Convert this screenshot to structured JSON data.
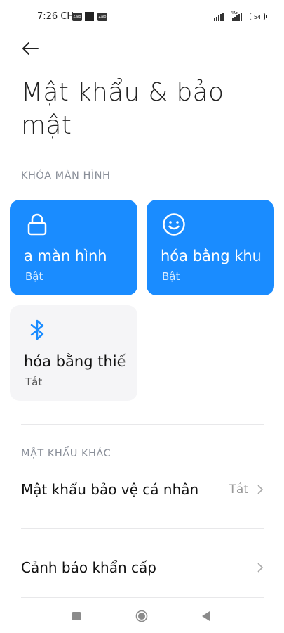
{
  "status_bar": {
    "time": "7:26 CH",
    "notif_1": "Zalo",
    "notif_2": "Zalo",
    "network": "4G",
    "battery": "54"
  },
  "header": {
    "back_icon": "back-arrow-icon",
    "title": "Mật khẩu & bảo mật"
  },
  "lock_screen_section": {
    "heading": "KHÓA MÀN HÌNH",
    "cards": [
      {
        "name": "a màn hình",
        "state": "Bật",
        "icon": "lock-icon",
        "active": true
      },
      {
        "name": "hóa bằng khu",
        "state": "Bật",
        "icon": "face-icon",
        "active": true
      },
      {
        "name": "hóa bằng thiế",
        "state": "Tắt",
        "icon": "bluetooth-icon",
        "active": false
      }
    ]
  },
  "other_section": {
    "heading": "MẬT KHẨU KHÁC",
    "rows": [
      {
        "label": "Mật khẩu bảo vệ cá nhân",
        "value": "Tắt"
      },
      {
        "label": "Cảnh báo khẩn cấp",
        "value": ""
      }
    ]
  },
  "colors": {
    "accent": "#1a8cff",
    "card_off": "#f5f5f7",
    "muted": "#8a8f99"
  }
}
